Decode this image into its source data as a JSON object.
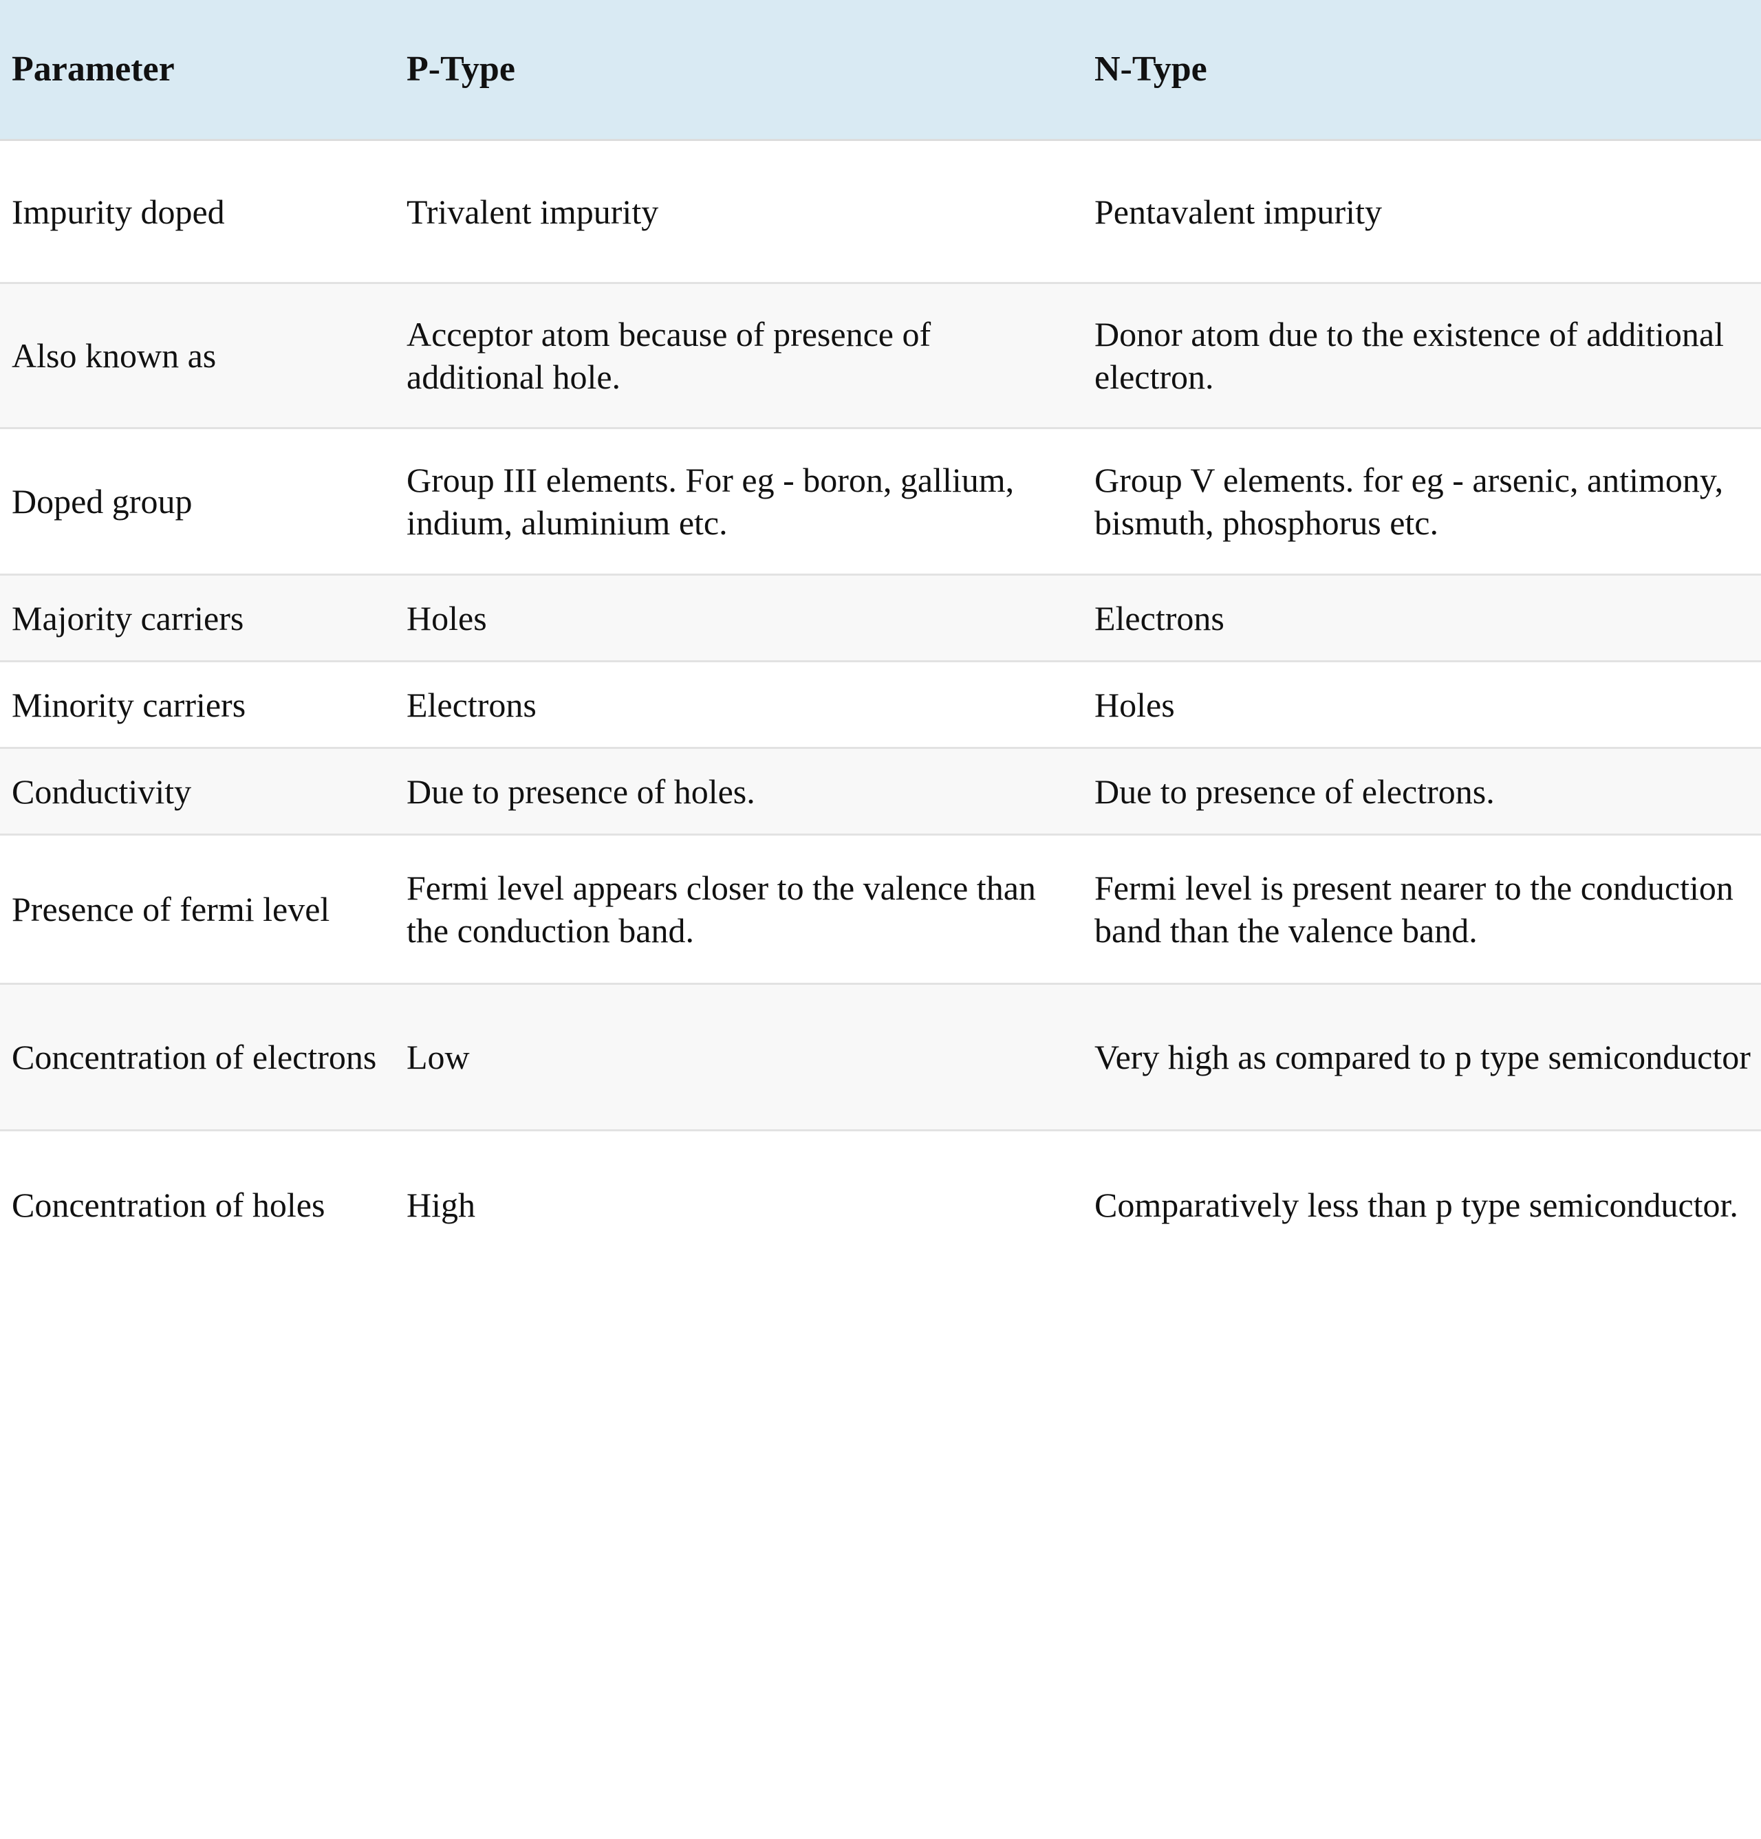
{
  "table": {
    "headers": {
      "parameter": "Parameter",
      "p_type": "P-Type",
      "n_type": "N-Type"
    },
    "colors": {
      "header_background": "#d9eaf3",
      "row_alt_background": "#f8f8f8",
      "row_background": "#ffffff",
      "row_separator": "#e2e2e2",
      "text": "#111111",
      "bottom_band": "#000000"
    },
    "rows": [
      {
        "parameter": "Impurity doped",
        "p_type": "Trivalent impurity",
        "n_type": "Pentavalent impurity"
      },
      {
        "parameter": "Also known as",
        "p_type": "Acceptor atom because of presence of additional hole.",
        "n_type": "Donor atom due to the existence of additional electron."
      },
      {
        "parameter": "Doped group",
        "p_type": "Group III elements. For eg - boron, gallium, indium, aluminium etc.",
        "n_type": "Group V elements. for eg - arsenic, antimony, bismuth, phosphorus etc."
      },
      {
        "parameter": "Majority carriers",
        "p_type": "Holes",
        "n_type": "Electrons"
      },
      {
        "parameter": "Minority carriers",
        "p_type": "Electrons",
        "n_type": "Holes"
      },
      {
        "parameter": "Conductivity",
        "p_type": "Due to presence of holes.",
        "n_type": "Due to presence of electrons."
      },
      {
        "parameter": "Presence of fermi level",
        "p_type": "Fermi level appears closer to the valence than the conduction band.",
        "n_type": "Fermi level is present nearer to the conduction band than the valence band."
      },
      {
        "parameter": "Concentration of electrons",
        "p_type": "Low",
        "n_type": "Very high as compared to p type semiconductor"
      },
      {
        "parameter": "Concentration of holes",
        "p_type": "High",
        "n_type": "Comparatively less than p type semiconductor."
      }
    ]
  }
}
